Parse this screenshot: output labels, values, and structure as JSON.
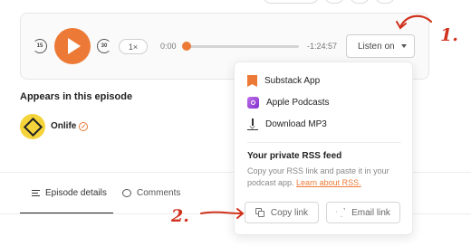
{
  "player": {
    "skip_back": "15",
    "skip_forward": "30",
    "speed": "1×",
    "time_start": "0:00",
    "time_remaining": "-1:24:57",
    "progress_fraction": 0.0,
    "listen_label": "Listen on"
  },
  "appears": {
    "heading": "Appears in this episode",
    "creator_name": "Onlife"
  },
  "tabs": {
    "details": "Episode details",
    "comments": "Comments"
  },
  "dropdown": {
    "items": [
      {
        "label": "Substack App"
      },
      {
        "label": "Apple Podcasts"
      },
      {
        "label": "Download MP3"
      }
    ],
    "rss_title": "Your private RSS feed",
    "rss_text": "Copy your RSS link and paste it in your podcast app. ",
    "rss_link": "Learn about RSS.",
    "copy_label": "Copy link",
    "email_label": "Email link"
  },
  "annotations": {
    "one": "1.",
    "two": "2."
  },
  "colors": {
    "accent": "#ec7a36",
    "annotation": "#d0331d"
  }
}
